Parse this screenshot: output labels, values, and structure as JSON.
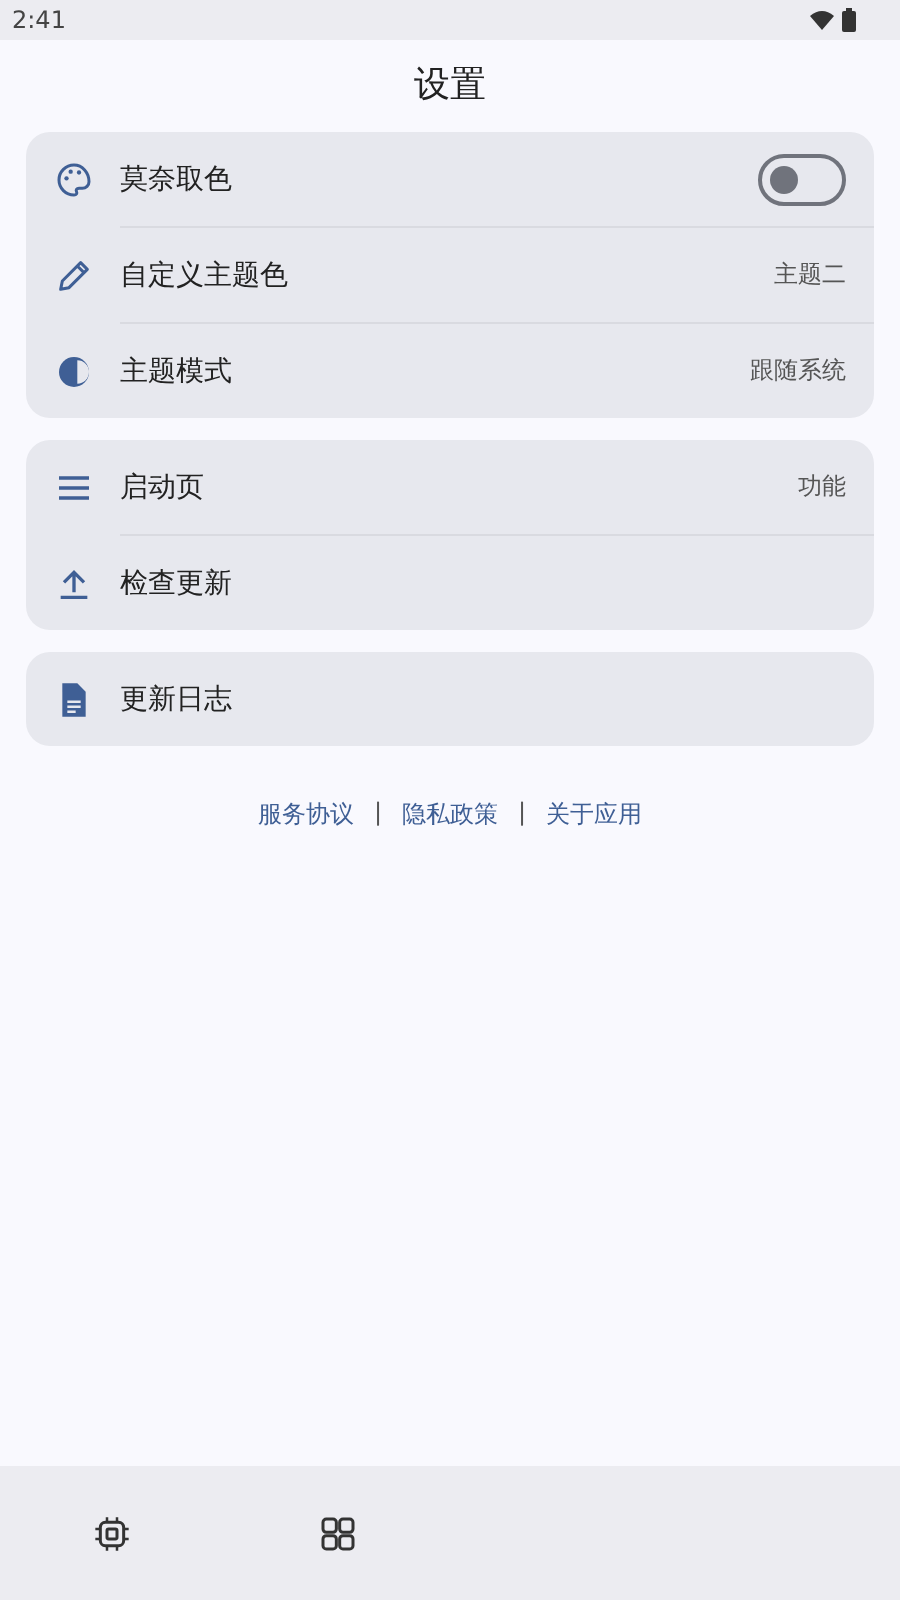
{
  "status_bar": {
    "time": "2:41"
  },
  "title": "设置",
  "groups": [
    {
      "rows": [
        {
          "kind": "toggle",
          "label": "莫奈取色",
          "on": false
        },
        {
          "kind": "value",
          "label": "自定义主题色",
          "value": "主题二"
        },
        {
          "kind": "value",
          "label": "主题模式",
          "value": "跟随系统"
        }
      ]
    },
    {
      "rows": [
        {
          "kind": "value",
          "label": "启动页",
          "value": "功能"
        },
        {
          "kind": "plain",
          "label": "检查更新"
        }
      ]
    },
    {
      "rows": [
        {
          "kind": "plain",
          "label": "更新日志"
        }
      ]
    }
  ],
  "footer_links": [
    "服务协议",
    "隐私政策",
    "关于应用"
  ],
  "footer_separator": "|"
}
